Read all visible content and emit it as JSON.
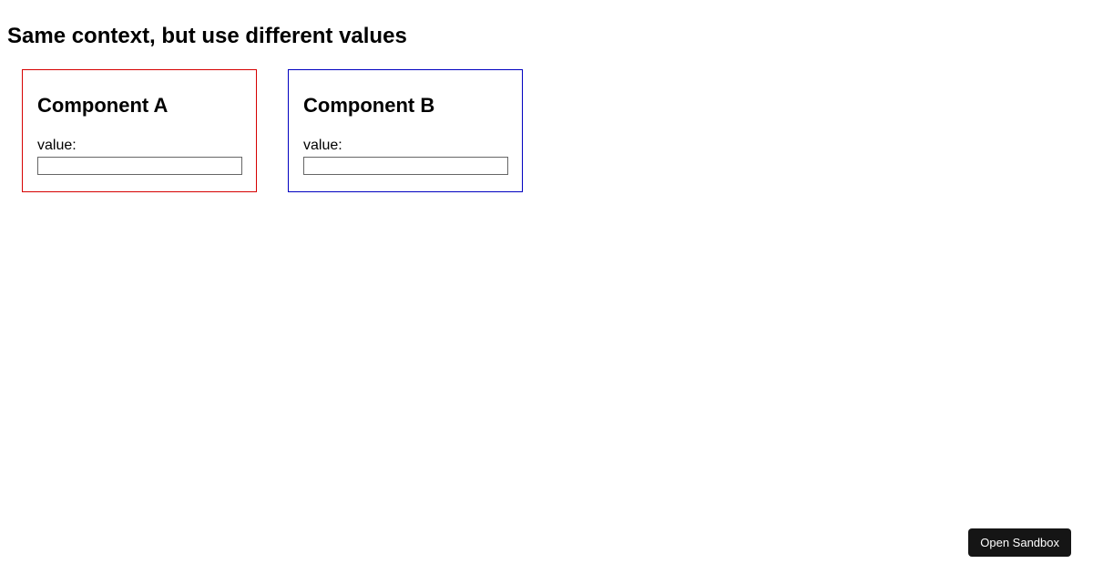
{
  "heading": "Same context, but use different values",
  "components": {
    "a": {
      "title": "Component A",
      "valueLabel": "value:",
      "inputValue": "",
      "borderColor": "#d60000"
    },
    "b": {
      "title": "Component B",
      "valueLabel": "value:",
      "inputValue": "",
      "borderColor": "#0000c0"
    }
  },
  "openSandboxLabel": "Open Sandbox"
}
